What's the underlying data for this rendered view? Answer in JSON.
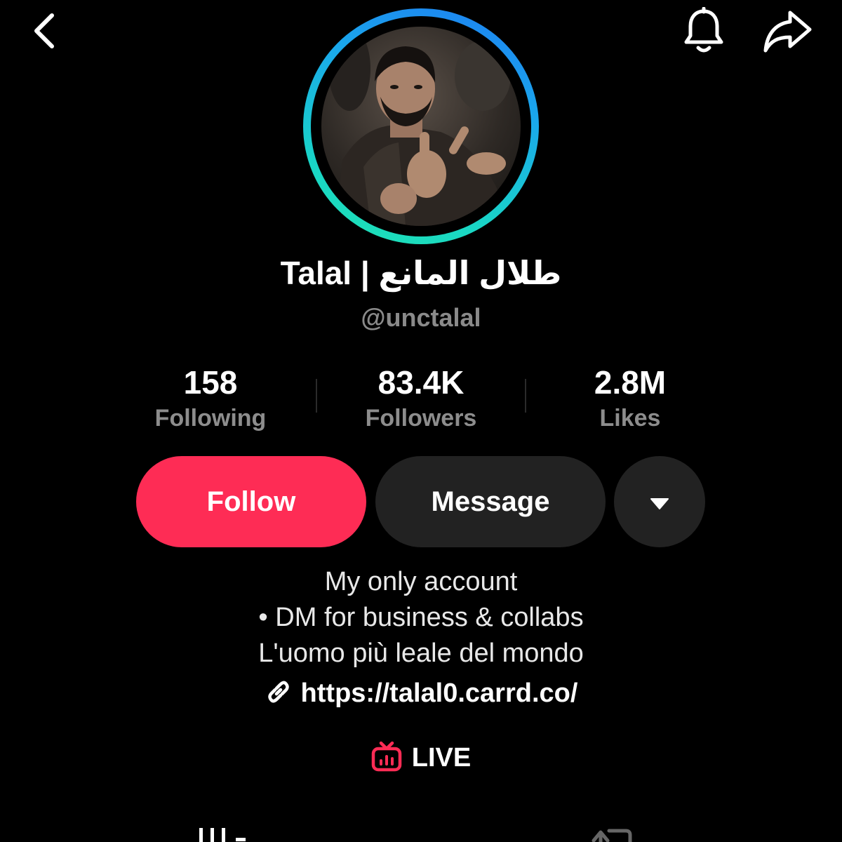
{
  "header": {
    "back_icon": "chevron-left-icon",
    "notification_icon": "bell-icon",
    "share_icon": "share-arrow-icon"
  },
  "profile": {
    "display_name": "Talal | طلال المانع",
    "handle": "@unctalal",
    "avatar_ring_colors": [
      "#1e7cf2",
      "#20e3b2"
    ]
  },
  "stats": {
    "following": {
      "value": "158",
      "label": "Following"
    },
    "followers": {
      "value": "83.4K",
      "label": "Followers"
    },
    "likes": {
      "value": "2.8M",
      "label": "Likes"
    }
  },
  "actions": {
    "follow_label": "Follow",
    "message_label": "Message",
    "more_icon": "caret-down-icon",
    "follow_color": "#fe2c55"
  },
  "bio": {
    "lines": [
      "My only account",
      "• DM for business & collabs",
      "L'uomo più leale del mondo"
    ],
    "link_icon": "link-icon",
    "link": "https://talal0.carrd.co/"
  },
  "live": {
    "icon": "live-tv-icon",
    "label": "LIVE",
    "icon_color": "#fe2c55"
  },
  "tabs": {
    "videos_icon": "grid-icon",
    "reposts_icon": "repost-icon"
  }
}
